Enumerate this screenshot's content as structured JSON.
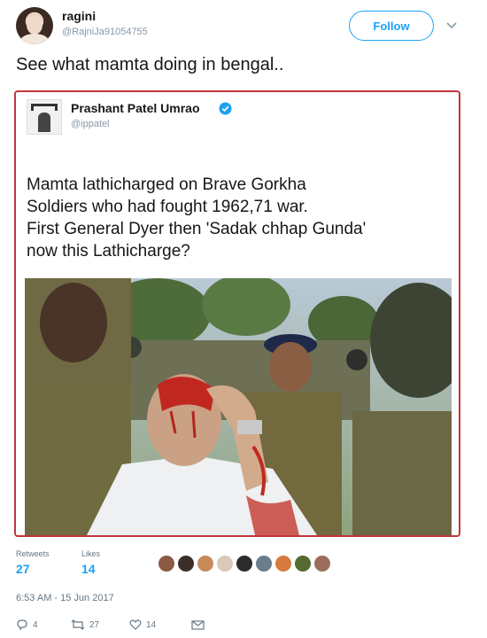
{
  "author": {
    "display_name": "ragini",
    "handle": "@RajniJa91054755",
    "avatar_icon": "profile-photo"
  },
  "follow_label": "Follow",
  "tweet_text": "See what mamta doing in bengal..",
  "quoted": {
    "display_name": "Prashant Patel Umrao",
    "handle": "@ippatel",
    "verified_icon": "verified-badge",
    "text_lines": [
      "Mamta lathicharged on Brave Gorkha",
      "Soldiers who had fought 1962,71 war.",
      "First General Dyer then 'Sadak chhap Gunda'",
      "now this Lathicharge?"
    ],
    "photo": "news photo of injured elderly man with bleeding head surrounded by police"
  },
  "stats": {
    "retweets_label": "Retweets",
    "retweets": "27",
    "likes_label": "Likes",
    "likes": "14",
    "liker_avatar_colors": [
      "#8a5a44",
      "#3b2f2a",
      "#c98a5a",
      "#d8c9b8",
      "#2b2b2b",
      "#6b7c8a",
      "#d67b3c",
      "#556b2f",
      "#9a6e5a"
    ]
  },
  "timestamp": "6:53 AM - 15 Jun 2017",
  "actions": {
    "reply_count": "4",
    "retweet_count": "27",
    "like_count": "14"
  },
  "colors": {
    "accent": "#1da1f2",
    "quote_border": "#c0363a",
    "muted": "#657786"
  }
}
